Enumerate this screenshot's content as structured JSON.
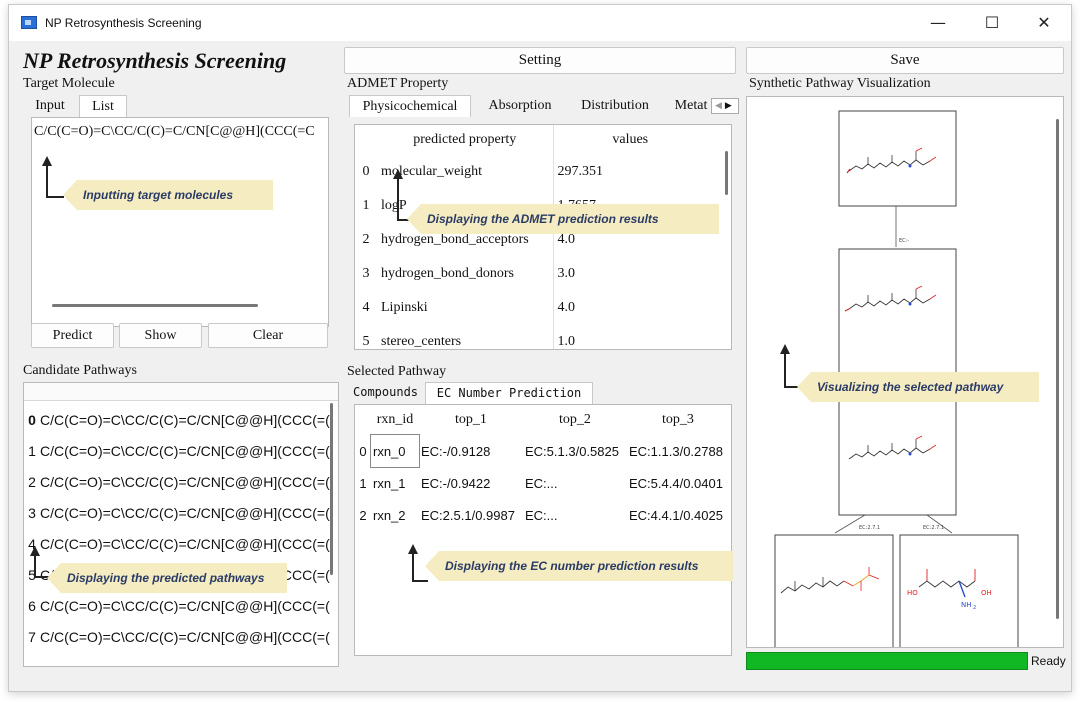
{
  "window": {
    "title": "NP Retrosynthesis Screening",
    "minimize": "—",
    "maximize": "☐",
    "close": "✕"
  },
  "app_title": "NP Retrosynthesis Screening",
  "toolbar": {
    "setting_label": "Setting",
    "save_label": "Save"
  },
  "target": {
    "heading": "Target Molecule",
    "tabs": [
      "Input",
      "List"
    ],
    "smiles": "C/C(C=O)=C\\CC/C(C)=C/CN[C@@H](CCC(=C",
    "annotation": "Inputting target molecules",
    "buttons": {
      "predict": "Predict",
      "show": "Show",
      "clear": "Clear"
    }
  },
  "admet": {
    "heading": "ADMET Property",
    "tabs": [
      "Physicochemical",
      "Absorption",
      "Distribution",
      "Metat"
    ],
    "columns": [
      "predicted property",
      "values"
    ],
    "rows": [
      {
        "idx": "0",
        "prop": "molecular_weight",
        "val": "297.351"
      },
      {
        "idx": "1",
        "prop": "logP",
        "val": "1.7657"
      },
      {
        "idx": "2",
        "prop": "hydrogen_bond_acceptors",
        "val": "4.0"
      },
      {
        "idx": "3",
        "prop": "hydrogen_bond_donors",
        "val": "3.0"
      },
      {
        "idx": "4",
        "prop": "Lipinski",
        "val": "4.0"
      },
      {
        "idx": "5",
        "prop": "stereo_centers",
        "val": "1.0"
      }
    ],
    "annotation": "Displaying the ADMET prediction results"
  },
  "candidates": {
    "heading": "Candidate Pathways",
    "rows": [
      {
        "idx": "0",
        "smiles": "C/C(C=O)=C\\CC/C(C)=C/CN[C@@H](CCC(=("
      },
      {
        "idx": "1",
        "smiles": "C/C(C=O)=C\\CC/C(C)=C/CN[C@@H](CCC(=("
      },
      {
        "idx": "2",
        "smiles": "C/C(C=O)=C\\CC/C(C)=C/CN[C@@H](CCC(=("
      },
      {
        "idx": "3",
        "smiles": "C/C(C=O)=C\\CC/C(C)=C/CN[C@@H](CCC(=("
      },
      {
        "idx": "4",
        "smiles": "C/C(C=O)=C\\CC/C(C)=C/CN[C@@H](CCC(=("
      },
      {
        "idx": "5",
        "smiles": "C/C(C=O)=C\\CC/C(C)=C/CN[C@@H](CCC(=("
      },
      {
        "idx": "6",
        "smiles": "C/C(C=O)=C\\CC/C(C)=C/CN[C@@H](CCC(=("
      },
      {
        "idx": "7",
        "smiles": "C/C(C=O)=C\\CC/C(C)=C/CN[C@@H](CCC(=("
      }
    ],
    "annotation": "Displaying the predicted pathways"
  },
  "selected": {
    "heading": "Selected Pathway",
    "tabs": [
      "Compounds",
      "EC Number Prediction"
    ],
    "columns": [
      "rxn_id",
      "top_1",
      "top_2",
      "top_3"
    ],
    "rows": [
      {
        "idx": "0",
        "rxn": "rxn_0",
        "t1": "EC:-/0.9128",
        "t2": "EC:5.1.3/0.5825",
        "t3": "EC:1.1.3/0.2788"
      },
      {
        "idx": "1",
        "rxn": "rxn_1",
        "t1": "EC:-/0.9422",
        "t2": "EC:...",
        "t3": "EC:5.4.4/0.0401"
      },
      {
        "idx": "2",
        "rxn": "rxn_2",
        "t1": "EC:2.5.1/0.9987",
        "t2": "EC:...",
        "t3": "EC:4.4.1/0.4025"
      }
    ],
    "annotation": "Displaying the EC number prediction results"
  },
  "visual": {
    "heading": "Synthetic Pathway Visualization",
    "annotation": "Visualizing the selected pathway",
    "edge_labels": [
      "EC:-",
      "EC:2.7.1",
      "EC:2.7.1"
    ],
    "atom_labels": {
      "ho": "HO",
      "oh": "OH",
      "nh2": "NH",
      "nh2_sub": "2"
    }
  },
  "status": {
    "progress": 1.0,
    "text": "Ready"
  },
  "colors": {
    "progress": "#12b824",
    "annotation_bg": "#f5ecc2",
    "annotation_text": "#2a3b66"
  }
}
